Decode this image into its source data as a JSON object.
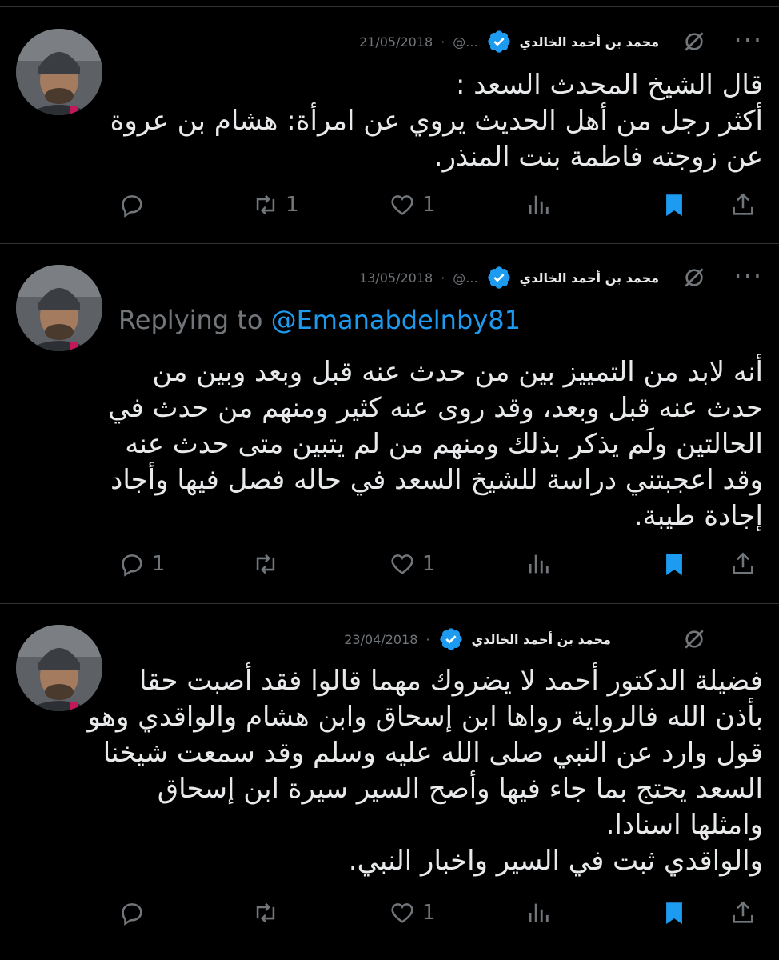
{
  "tweets": [
    {
      "author": "محمد بن أحمد الخالدي",
      "handle": "@...",
      "separator": "·",
      "date": "21/05/2018",
      "reply_prefix": "",
      "reply_mention": "",
      "text": "قال الشيخ المحدث السعد :\nأكثر رجل من أهل الحديث يروي عن امرأة: هشام بن عروة\nعن زوجته فاطمة بنت المنذر.",
      "counts": {
        "reply": "",
        "retweet": "1",
        "like": "1"
      }
    },
    {
      "author": "محمد بن أحمد الخالدي",
      "handle": "@...",
      "separator": "·",
      "date": "13/05/2018",
      "reply_prefix": "Replying to ",
      "reply_mention": "@Emanabdelnby81",
      "text": "أنه لابد من التمييز بين من حدث عنه قبل وبعد وبين من\nحدث عنه قبل وبعد، وقد روى عنه كثير ومنهم من حدث في\nالحالتين ولَم يذكر بذلك ومنهم من لم يتبين متى حدث عنه\nوقد اعجبتني دراسة للشيخ السعد في حاله فصل فيها وأجاد\nإجادة طيبة.",
      "counts": {
        "reply": "1",
        "retweet": "",
        "like": "1"
      }
    },
    {
      "author": "محمد بن أحمد الخالدي",
      "handle": "",
      "separator": "·",
      "date": "23/04/2018",
      "reply_prefix": "",
      "reply_mention": "",
      "text": "فضيلة الدكتور أحمد لا يضروك مهما قالوا فقد أصبت حقا\nبأذن الله فالرواية رواها ابن إسحاق وابن هشام والواقدي وهو\nقول وارد عن النبي صلى الله عليه وسلم وقد سمعت شيخنا\nالسعد يحتج بما جاء فيها وأصح السير سيرة ابن إسحاق\nوامثلها اسنادا.\nوالواقدي ثبت في السير واخبار النبي.",
      "counts": {
        "reply": "",
        "retweet": "",
        "like": "1"
      }
    }
  ],
  "icons": {
    "verified": "verified-badge-icon",
    "grok": "grok-icon",
    "more": "more-icon",
    "reply": "reply-icon",
    "retweet": "retweet-icon",
    "like": "like-icon",
    "views": "views-icon",
    "bookmark": "bookmark-icon",
    "share": "share-icon"
  },
  "colors": {
    "background": "#000000",
    "text": "#e7e9ea",
    "muted": "#71767b",
    "accent": "#1d9bf0",
    "divider": "#2f3336"
  },
  "more_label": "···"
}
